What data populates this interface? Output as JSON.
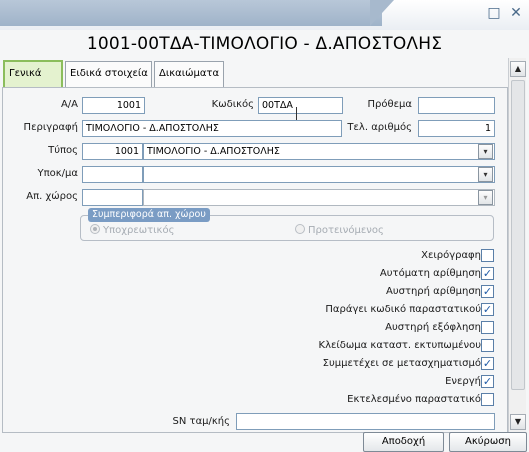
{
  "window": {
    "title": "1001-00ΤΔΑ-ΤΙΜΟΛΟΓΙΟ - Δ.ΑΠΟΣΤΟΛΗΣ",
    "minimize_glyph": "□",
    "close_glyph": "✕"
  },
  "tabs": [
    {
      "label": "Γενικά"
    },
    {
      "label": "Ειδικά στοιχεία"
    },
    {
      "label": "Δικαιώματα"
    }
  ],
  "fields": {
    "aa": {
      "label": "Α/Α",
      "value": "1001"
    },
    "kodikos": {
      "label": "Κωδικός",
      "value": "00ΤΔΑ"
    },
    "prothema": {
      "label": "Πρόθεμα",
      "value": ""
    },
    "perigrafi": {
      "label": "Περιγραφή",
      "value": "ΤΙΜΟΛΟΓΙΟ - Δ.ΑΠΟΣΤΟΛΗΣ"
    },
    "tel_arithmos": {
      "label": "Τελ. αριθμός",
      "value": "1"
    },
    "typos": {
      "label": "Τύπος",
      "code": "1001",
      "value": "ΤΙΜΟΛΟΓΙΟ - Δ.ΑΠΟΣΤΟΛΗΣ"
    },
    "ypokma": {
      "label": "Υποκ/μα",
      "code": "",
      "value": ""
    },
    "ap_xoros": {
      "label": "Απ. χώρος",
      "code": "",
      "value": ""
    },
    "sn": {
      "label": "SN ταμ/κής",
      "value": ""
    }
  },
  "group": {
    "legend": "Συμπεριφορά απ. χώρου",
    "options": [
      {
        "label": "Υποχρεωτικός",
        "selected": true
      },
      {
        "label": "Προτεινόμενος",
        "selected": false
      }
    ]
  },
  "checkboxes": [
    {
      "label": "Χειρόγραφη",
      "checked": false
    },
    {
      "label": "Αυτόματη αρίθμηση",
      "checked": true
    },
    {
      "label": "Αυστηρή αρίθμηση",
      "checked": true
    },
    {
      "label": "Παράγει κωδικό παραστατικού",
      "checked": true
    },
    {
      "label": "Αυστηρή εξόφληση",
      "checked": false
    },
    {
      "label": "Κλείδωμα καταστ. εκτυπωμένου",
      "checked": false
    },
    {
      "label": "Συμμετέχει σε μετασχηματισμό",
      "checked": true
    },
    {
      "label": "Ενεργή",
      "checked": true
    },
    {
      "label": "Εκτελεσμένο παραστατικό",
      "checked": false
    }
  ],
  "buttons": {
    "ok": "Αποδοχή",
    "cancel": "Ακύρωση"
  },
  "icons": {
    "dropdown": "▾",
    "scroll_up": "▲",
    "scroll_down": "▼",
    "check": "✓"
  }
}
